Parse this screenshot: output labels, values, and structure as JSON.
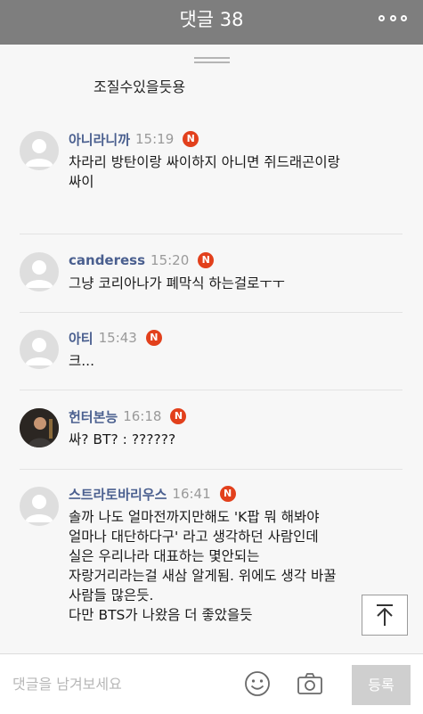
{
  "header": {
    "title": "댓글 38",
    "more_icon": "more-dots-icon"
  },
  "previous_comment": {
    "text": "조질수있을듯용"
  },
  "comments": [
    {
      "author": "아니라니까",
      "time": "15:19",
      "badge": "N",
      "text": "차라리 방탄이랑 싸이하지 아니면 쥐드래곤이랑\n싸이"
    },
    {
      "author": "canderess",
      "time": "15:20",
      "badge": "N",
      "text": "그냥 코리아나가 폐막식 하는걸로ㅜㅜ"
    },
    {
      "author": "아티",
      "time": "15:43",
      "badge": "N",
      "text": "크..."
    },
    {
      "author": "헌터본능",
      "time": "16:18",
      "badge": "N",
      "text": "싸? BT? : ??????"
    },
    {
      "author": "스트라토바리우스",
      "time": "16:41",
      "badge": "N",
      "text": "솔까 나도 얼마전까지만해도 'K팝 뭐 해봐야\n얼마나 대단하다구' 라고 생각하던 사람인데\n실은 우리나라 대표하는 몇안되는\n자랑거리라는걸 새삼 알게됨. 위에도 생각 바꿀\n사람들 많은듯.\n다만 BTS가 나왔음 더 좋았을듯"
    }
  ],
  "footer": {
    "input_placeholder": "댓글을 남겨보세요",
    "emoji_icon": "emoji-icon",
    "camera_icon": "camera-icon",
    "submit_label": "등록"
  },
  "colors": {
    "header_bg": "#7e7e7e",
    "author": "#4a5f8f",
    "badge": "#e2401c",
    "submit_bg": "#cfcfcf"
  }
}
